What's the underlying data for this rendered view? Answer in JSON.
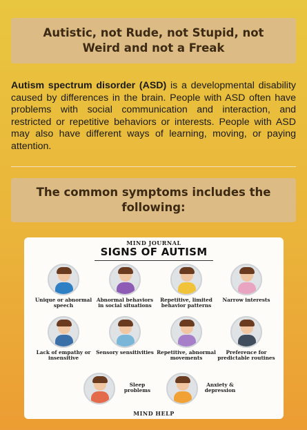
{
  "header": {
    "title": "Autistic, not Rude, not Stupid, not Weird and not a Freak"
  },
  "intro": {
    "lead": "Autism spectrum disorder (ASD)",
    "body": " is a developmental disability caused by differences in the brain. People with ASD often have problems with social communication and interaction, and restricted or repetitive behaviors or interests. People with ASD may also have different ways of learning, moving, or paying attention."
  },
  "section": {
    "title": "The common symptoms includes the following:"
  },
  "infographic": {
    "brand_top": "MIND JOURNAL",
    "title": "SIGNS OF AUTISM",
    "brand_bottom": "MIND HELP",
    "signs": [
      {
        "label": "Unique or abnormal speech",
        "color": "#2f7fc4",
        "icon": "speaking-child-icon"
      },
      {
        "label": "Abnormal behaviors in social situations",
        "color": "#8e5bb5",
        "icon": "social-situation-icon"
      },
      {
        "label": "Repetitive, limited behavior patterns",
        "color": "#f1c33a",
        "icon": "repetitive-behavior-icon"
      },
      {
        "label": "Narrow interests",
        "color": "#e8a4c0",
        "icon": "narrow-interests-icon"
      },
      {
        "label": "Lack of empathy or insensitive",
        "color": "#3b6fa8",
        "icon": "lack-of-empathy-icon"
      },
      {
        "label": "Sensory sensitivities",
        "color": "#7ab6d8",
        "icon": "sensory-sensitivity-icon"
      },
      {
        "label": "Repetitive, abnormal movements",
        "color": "#a77fc9",
        "icon": "repetitive-movement-icon"
      },
      {
        "label": "Preference for predictable routines",
        "color": "#3f4d5c",
        "icon": "predictable-routine-icon"
      },
      {
        "label": "Sleep problems",
        "color": "#e36a4a",
        "icon": "sleep-problem-icon"
      },
      {
        "label": "Anxiety & depression",
        "color": "#f0a237",
        "icon": "anxiety-icon"
      }
    ]
  }
}
